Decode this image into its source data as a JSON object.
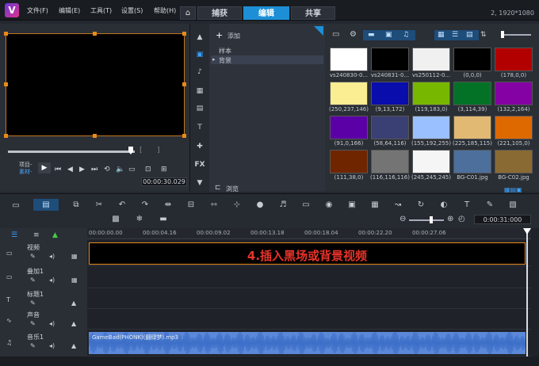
{
  "menu": [
    "文件(F)",
    "编辑(E)",
    "工具(T)",
    "设置(S)",
    "帮助(H)"
  ],
  "tabs": {
    "capture": "捕获",
    "edit": "编辑",
    "share": "共享"
  },
  "resolution": "2, 1920*1080",
  "library": {
    "add_label": "添加",
    "tree": [
      "样本",
      "背景"
    ],
    "browse_label": "浏览",
    "thumbs": [
      {
        "label": "vs240830-0...",
        "color": "#ffffff"
      },
      {
        "label": "vs240831-0...",
        "color": "#000000"
      },
      {
        "label": "vs250112-0...",
        "color": "#f0f0f0"
      },
      {
        "label": "(0,0,0)",
        "color": "#000000"
      },
      {
        "label": "(178,0,0)",
        "color": "#b20000"
      },
      {
        "label": "(250,237,146)",
        "color": "#faed92"
      },
      {
        "label": "(9,13,172)",
        "color": "#090dac"
      },
      {
        "label": "(119,183,0)",
        "color": "#77b700"
      },
      {
        "label": "(3,114,39)",
        "color": "#037227"
      },
      {
        "label": "(132,2,164)",
        "color": "#8402a4"
      },
      {
        "label": "(91,0,166)",
        "color": "#5b00a6"
      },
      {
        "label": "(58,64,116)",
        "color": "#3a4074"
      },
      {
        "label": "(155,192,255)",
        "color": "#9bc0ff"
      },
      {
        "label": "(225,185,115)",
        "color": "#e1b973"
      },
      {
        "label": "(221,105,0)",
        "color": "#dd6900"
      },
      {
        "label": "(111,38,0)",
        "color": "#6f2600"
      },
      {
        "label": "(116,116,116)",
        "color": "#747474"
      },
      {
        "label": "(245,245,245)",
        "color": "#f5f5f5"
      },
      {
        "label": "BG-C01.jpg",
        "color": "#4c6f9c"
      },
      {
        "label": "BG-C02.jpg",
        "color": "#8a6a33"
      }
    ]
  },
  "player": {
    "project_label": "项目-",
    "clip_label": "素材-",
    "timecode": "00:00:30.029"
  },
  "timeline": {
    "timecode": "0:00:31:000",
    "ruler": [
      "00:00:00.00",
      "00:00:04.16",
      "00:00:09.02",
      "00:00:13.18",
      "00:00:18.04",
      "00:00:22.20",
      "00:00:27.06"
    ],
    "tracks": [
      "视频",
      "叠加1",
      "标题1",
      "声音",
      "音乐1"
    ],
    "video_clip_text": "4.插入黑场或背景视频",
    "audio_clip_text": "GameBad(PHONK)(翻绿梦).mp3"
  },
  "colors": {
    "accent": "#1e8fd6",
    "clip_border": "#e88a1a",
    "overlay_text": "#e8332a",
    "audio": "#5b88d8"
  }
}
